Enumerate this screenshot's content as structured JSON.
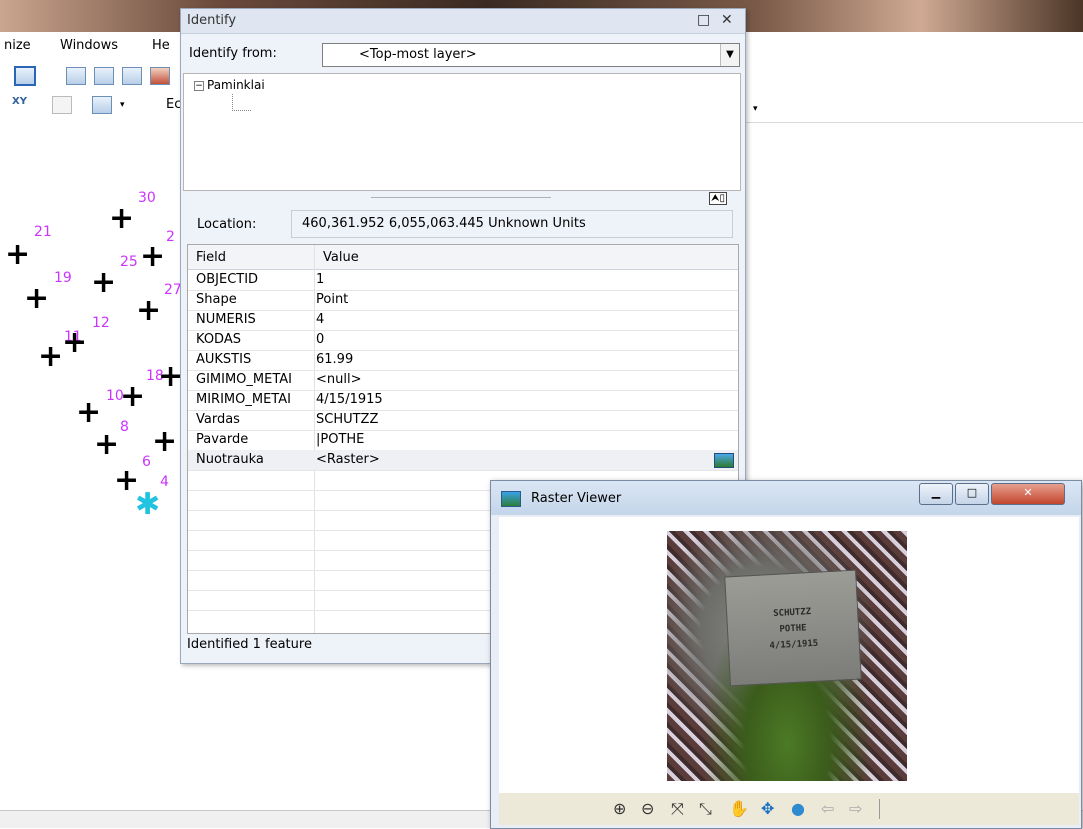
{
  "menubar": {
    "items": [
      "nize",
      "Windows",
      "He"
    ]
  },
  "toolbar2": {
    "edit_label": "Ec"
  },
  "map_points": [
    {
      "label": "30"
    },
    {
      "label": "21"
    },
    {
      "label": "2"
    },
    {
      "label": "25"
    },
    {
      "label": "19"
    },
    {
      "label": "27"
    },
    {
      "label": "12"
    },
    {
      "label": "11"
    },
    {
      "label": "18"
    },
    {
      "label": "10"
    },
    {
      "label": "8"
    },
    {
      "label": "6"
    },
    {
      "label": "4"
    }
  ],
  "identify": {
    "title": "Identify",
    "from_label": "Identify from:",
    "from_value": "<Top-most layer>",
    "tree_root": "Paminklai",
    "location_label": "Location:",
    "location_value": "460,361.952  6,055,063.445 Unknown Units",
    "columns": [
      "Field",
      "Value"
    ],
    "rows": [
      {
        "field": "OBJECTID",
        "value": "1"
      },
      {
        "field": "Shape",
        "value": "Point"
      },
      {
        "field": "NUMERIS",
        "value": "4"
      },
      {
        "field": "KODAS",
        "value": "0"
      },
      {
        "field": "AUKSTIS",
        "value": "61.99"
      },
      {
        "field": "GIMIMO_METAI",
        "value": "<null>"
      },
      {
        "field": "MIRIMO_METAI",
        "value": "4/15/1915"
      },
      {
        "field": "Vardas",
        "value": "SCHUTZZ"
      },
      {
        "field": "Pavarde",
        "value": "|POTHE"
      },
      {
        "field": "Nuotrauka",
        "value": "<Raster>"
      }
    ],
    "status": "Identified 1 feature"
  },
  "raster_viewer": {
    "title": "Raster Viewer",
    "stone_lines": [
      "SCHUTZZ",
      "POTHE",
      "4/15/1915"
    ]
  },
  "colors": {
    "point_label": "#cc33ff",
    "selected_point": "#22c3e0"
  }
}
